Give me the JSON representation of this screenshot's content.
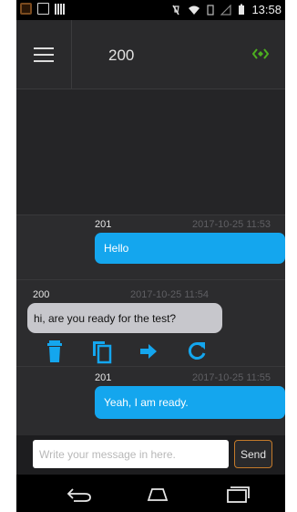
{
  "status_bar": {
    "time": "13:58"
  },
  "header": {
    "title": "200"
  },
  "messages": [
    {
      "sender": "201",
      "timestamp": "2017-10-25 11:53",
      "text": "Hello",
      "direction": "outgoing"
    },
    {
      "sender": "200",
      "timestamp": "2017-10-25 11:54",
      "text": "hi, are you ready for the test?",
      "direction": "incoming"
    },
    {
      "sender": "201",
      "timestamp": "2017-10-25 11:55",
      "text": "Yeah,  I am ready.",
      "direction": "outgoing"
    }
  ],
  "message_actions": [
    "trash-icon",
    "copy-icon",
    "forward-arrow-icon",
    "refresh-icon"
  ],
  "composer": {
    "placeholder": "Write your message in here.",
    "value": "",
    "send_label": "Send"
  },
  "navigation": [
    "back-icon",
    "home-icon",
    "recents-icon"
  ],
  "colors": {
    "accent_blue": "#14a6ee",
    "incoming_bubble": "#c7c7cc",
    "signal_green": "#4caf1f",
    "send_border": "#c47a2a",
    "background": "#222224"
  }
}
